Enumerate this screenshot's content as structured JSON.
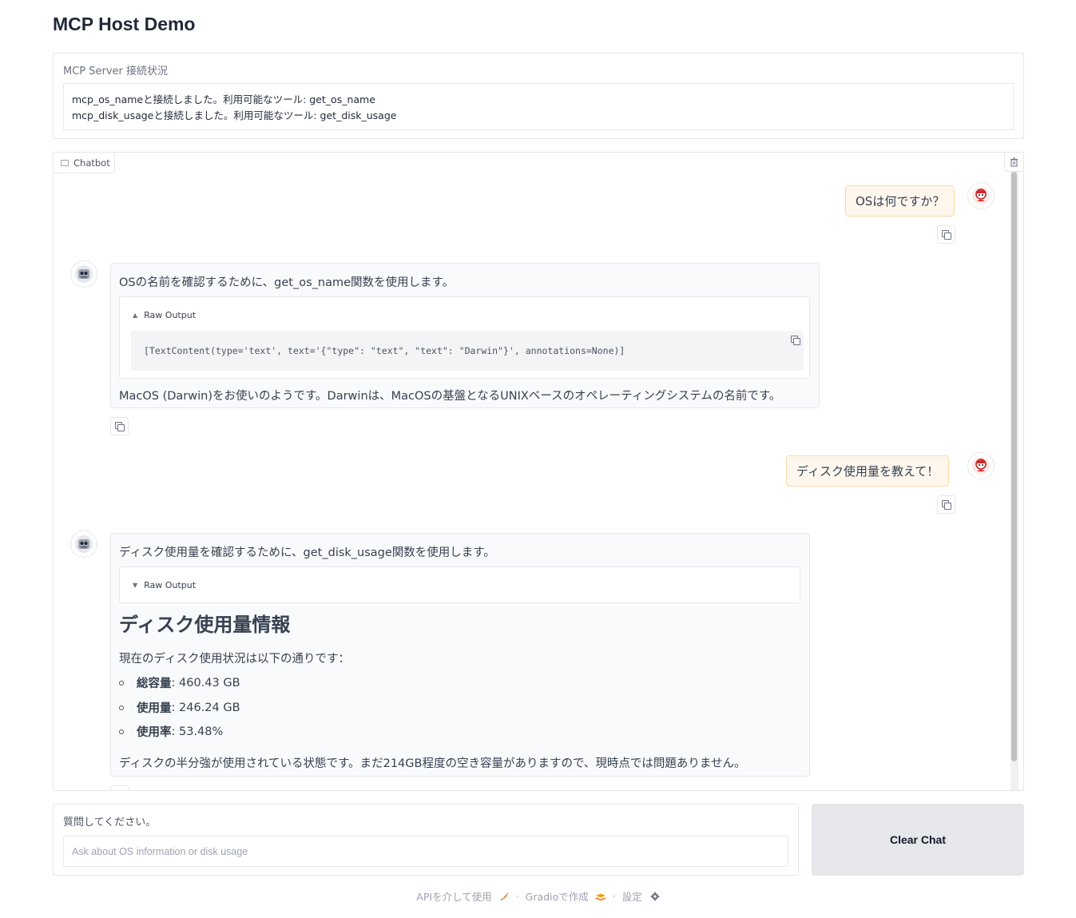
{
  "app": {
    "title": "MCP Host Demo"
  },
  "status": {
    "label": "MCP Server 接続状況",
    "lines": [
      "mcp_os_nameと接続しました。利用可能なツール: get_os_name",
      "mcp_disk_usageと接続しました。利用可能なツール: get_disk_usage"
    ]
  },
  "chatbot": {
    "tab_label": "Chatbot",
    "messages": [
      {
        "role": "user",
        "text": "OSは何ですか？"
      },
      {
        "role": "bot",
        "intro": "OSの名前を確認するために、get_os_name関数を使用します。",
        "raw_output_label": "Raw Output",
        "raw_output_code": "[TextContent(type='text', text='{\"type\": \"text\", \"text\": \"Darwin\"}', annotations=None)]",
        "conclusion": "MacOS (Darwin)をお使いのようです。Darwinは、MacOSの基盤となるUNIXベースのオペレーティングシステムの名前です。"
      },
      {
        "role": "user",
        "text": "ディスク使用量を教えて！"
      },
      {
        "role": "bot",
        "intro": "ディスク使用量を確認するために、get_disk_usage関数を使用します。",
        "raw_output_label": "Raw Output",
        "heading": "ディスク使用量情報",
        "paragraph": "現在のディスク使用状況は以下の通りです：",
        "items": [
          {
            "key": "総容量",
            "value": ": 460.43 GB"
          },
          {
            "key": "使用量",
            "value": ": 246.24 GB"
          },
          {
            "key": "使用率",
            "value": ": 53.48%"
          }
        ],
        "conclusion": "ディスクの半分強が使用されている状態です。まだ214GB程度の空き容量がありますので、現時点では問題ありません。"
      }
    ]
  },
  "input": {
    "label": "質問してください。",
    "placeholder": "Ask about OS information or disk usage",
    "value": ""
  },
  "actions": {
    "clear_label": "Clear Chat"
  },
  "footer": {
    "api_label": "APIを介して使用",
    "gradio_label": "Gradioで作成",
    "settings_label": "設定"
  },
  "icons": {
    "user_avatar": "user-avatar-icon",
    "bot_avatar": "robot-avatar-icon",
    "copy": "copy-icon",
    "trash": "trash-icon",
    "chat": "chat-icon",
    "chevron_up": "chevron-up-icon",
    "chevron_down": "chevron-down-icon",
    "rocket": "rocket-icon",
    "gradio_logo": "gradio-logo-icon",
    "gear": "gear-icon"
  }
}
